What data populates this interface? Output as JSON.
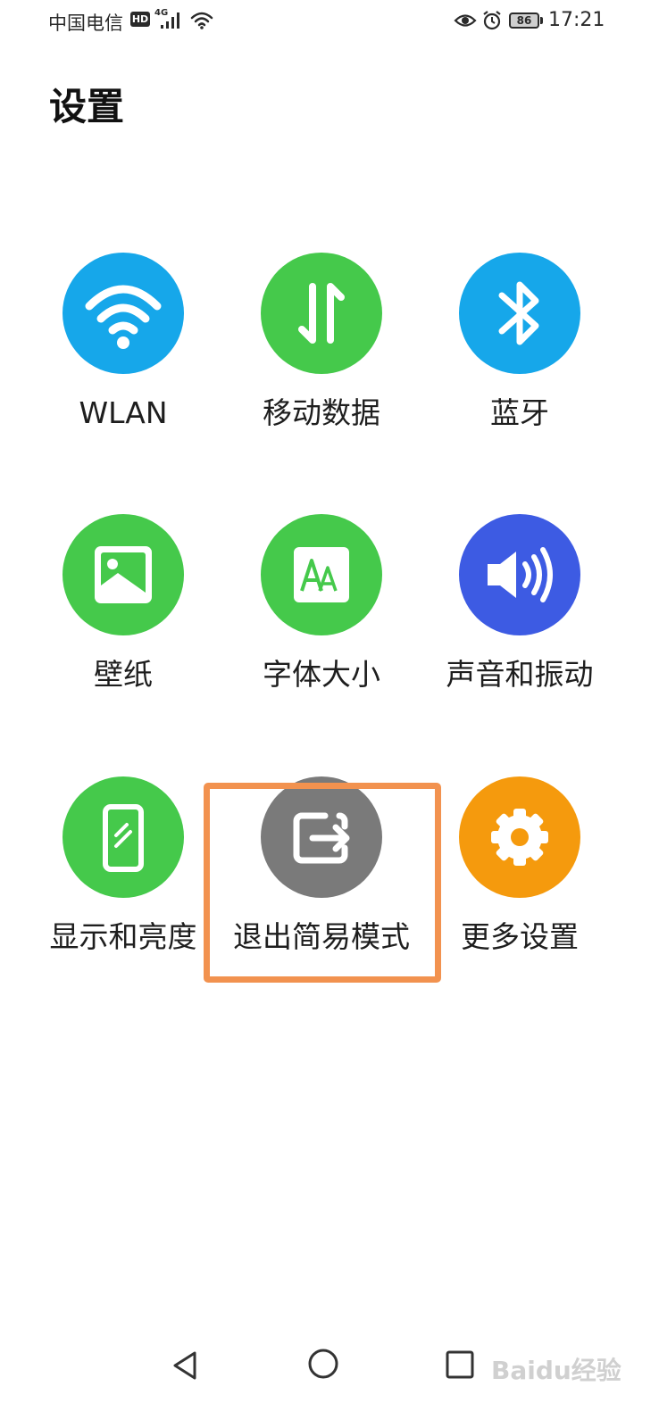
{
  "status_bar": {
    "carrier": "中国电信",
    "hd": "HD",
    "network": "4G",
    "battery": "86",
    "time": "17:21"
  },
  "page": {
    "title": "设置"
  },
  "tiles": [
    {
      "label": "WLAN",
      "icon": "wifi-icon",
      "color": "#16a7ea"
    },
    {
      "label": "移动数据",
      "icon": "mobile-data-icon",
      "color": "#45c94b"
    },
    {
      "label": "蓝牙",
      "icon": "bluetooth-icon",
      "color": "#16a7ea"
    },
    {
      "label": "壁纸",
      "icon": "wallpaper-icon",
      "color": "#45c94b"
    },
    {
      "label": "字体大小",
      "icon": "font-size-icon",
      "color": "#45c94b"
    },
    {
      "label": "声音和振动",
      "icon": "sound-icon",
      "color": "#3d5be3"
    },
    {
      "label": "显示和亮度",
      "icon": "phone-display-icon",
      "color": "#45c94b"
    },
    {
      "label": "退出简易模式",
      "icon": "exit-icon",
      "color": "#7a7a7a"
    },
    {
      "label": "更多设置",
      "icon": "gear-icon",
      "color": "#f59a0d"
    }
  ],
  "highlight_color": "#f2924f",
  "nav": {
    "watermark": "Baidu经验"
  }
}
